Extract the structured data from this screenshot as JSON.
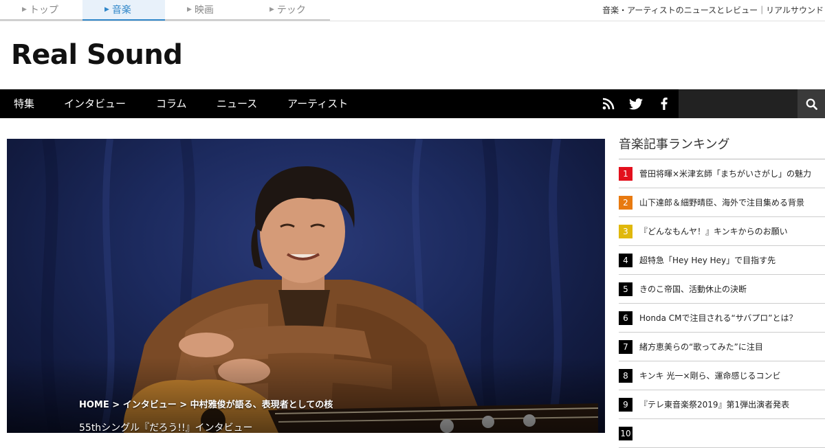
{
  "categories": [
    {
      "label": "トップ",
      "active": false
    },
    {
      "label": "音楽",
      "active": true
    },
    {
      "label": "映画",
      "active": false
    },
    {
      "label": "テック",
      "active": false
    }
  ],
  "tagline": "音楽・アーティストのニュースとレビュー｜リアルサウンド",
  "logo": "Real Sound",
  "nav": {
    "items": [
      "特集",
      "インタビュー",
      "コラム",
      "ニュース",
      "アーティスト"
    ],
    "social": [
      "rss-icon",
      "twitter-icon",
      "facebook-icon"
    ],
    "search_value": "",
    "search_icon": "search-icon"
  },
  "hero": {
    "breadcrumb": "HOME > インタビュー > 中村雅俊が語る、表現者としての核",
    "subtitle": "55thシングル『だろう!!』インタビュー"
  },
  "ranking": {
    "title": "音楽記事ランキング",
    "items": [
      {
        "rank": "1",
        "text": "菅田将暉×米津玄師「まちがいさがし」の魅力",
        "color": "#e3101d"
      },
      {
        "rank": "2",
        "text": "山下達郎＆細野晴臣、海外で注目集める背景",
        "color": "#e87a10"
      },
      {
        "rank": "3",
        "text": "『どんなもんヤ！』キンキからのお願い",
        "color": "#e0b80c"
      },
      {
        "rank": "4",
        "text": "超特急「Hey Hey Hey」で目指す先",
        "color": "#000000"
      },
      {
        "rank": "5",
        "text": "きのこ帝国、活動休止の決断",
        "color": "#000000"
      },
      {
        "rank": "6",
        "text": "Honda CMで注目される“サバプロ”とは？",
        "color": "#000000"
      },
      {
        "rank": "7",
        "text": "緒方恵美らの“歌ってみた”に注目",
        "color": "#000000"
      },
      {
        "rank": "8",
        "text": "キンキ 光一×剛ら、運命感じるコンビ",
        "color": "#000000"
      },
      {
        "rank": "9",
        "text": "『テレ東音楽祭2019』第1弾出演者発表",
        "color": "#000000"
      },
      {
        "rank": "10",
        "text": "",
        "color": "#000000"
      }
    ]
  }
}
